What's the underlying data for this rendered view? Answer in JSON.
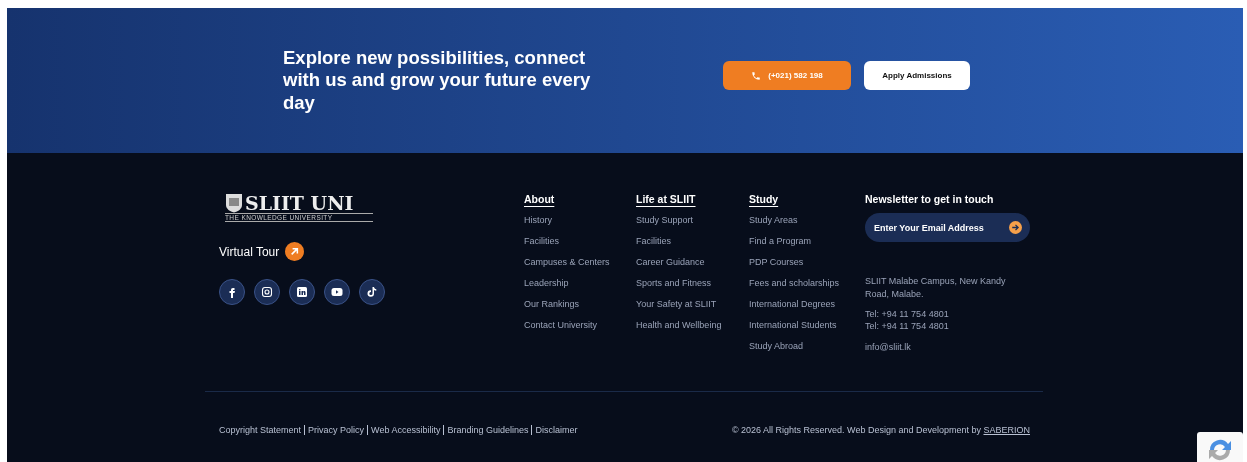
{
  "banner": {
    "heading": "Explore new possibilities, connect with us and grow your future every day",
    "phone_button": "(+021) 582 198",
    "apply_button": "Apply Admissions"
  },
  "brand": {
    "logo": "SLIIT UNI",
    "tagline": "THE KNOWLEDGE UNIVERSITY",
    "virtual_tour": "Virtual Tour",
    "social": [
      {
        "kind": "facebook"
      },
      {
        "kind": "instagram"
      },
      {
        "kind": "linkedin"
      },
      {
        "kind": "youtube"
      },
      {
        "kind": "tiktok"
      }
    ]
  },
  "columns": [
    {
      "title": "About",
      "links": [
        "History",
        "Facilities",
        "Campuses & Centers",
        "Leadership",
        "Our Rankings",
        "Contact University"
      ]
    },
    {
      "title": "Life at SLIIT",
      "links": [
        "Study Support",
        "Facilities",
        "Career Guidance",
        "Sports and Fitness",
        "Your Safety at SLIIT",
        "Health and Wellbeing"
      ]
    },
    {
      "title": "Study",
      "links": [
        "Study Areas",
        "Find a Program",
        "PDP Courses",
        "Fees and scholarships",
        "International Degrees",
        "International Students",
        "Study Abroad"
      ]
    }
  ],
  "newsletter": {
    "title": "Newsletter to get in touch",
    "placeholder": "Enter Your Email Address",
    "address": "SLIIT Malabe Campus, New Kandy Road, Malabe.",
    "phones": [
      "Tel: +94 11 754 4801",
      "Tel: +94 11 754 4801"
    ],
    "email": "info@sliit.lk"
  },
  "bottom": {
    "links": [
      "Copyright Statement",
      "Privacy Policy",
      "Web Accessibility",
      "Branding Guidelines",
      "Disclaimer"
    ],
    "copyright": "© 2026 All Rights Reserved. Web Design and Development by",
    "credit": "SABERION"
  }
}
